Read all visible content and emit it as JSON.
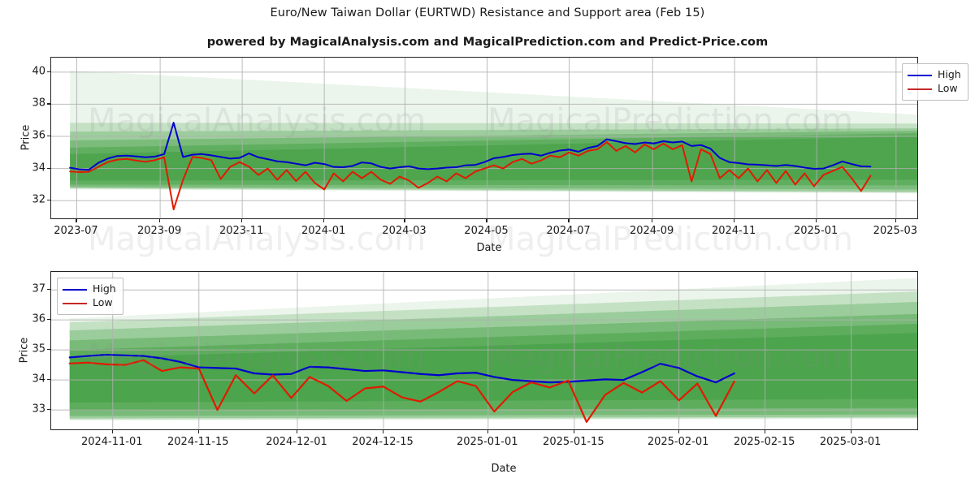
{
  "title": "Euro/New Taiwan Dollar (EURTWD) Resistance and Support area (Feb 15)",
  "subtitle": "powered by MagicalAnalysis.com and MagicalPrediction.com and Predict-Price.com",
  "watermarks": {
    "left": "MagicalAnalysis.com",
    "right": "MagicalPrediction.com"
  },
  "colors": {
    "high": "#0000cd",
    "low": "#e01b00",
    "legend_high": "#0000cd",
    "legend_low": "#c62828",
    "band": "#3a9b3a",
    "grid": "#b0b0b0",
    "axis": "#222222",
    "text": "#1a1a1a"
  },
  "chart_data": [
    {
      "type": "line",
      "id": "overview",
      "title": "Euro/New Taiwan Dollar (EURTWD) Resistance and Support area (Feb 15)",
      "xlabel": "Date",
      "ylabel": "Price",
      "ylim": [
        30.8,
        40.9
      ],
      "yticks": [
        32,
        34,
        36,
        38,
        40
      ],
      "xlim": [
        "2023-06-12",
        "2025-03-18"
      ],
      "xticks": [
        "2023-07",
        "2023-09",
        "2023-11",
        "2024-01",
        "2024-03",
        "2024-05",
        "2024-07",
        "2024-09",
        "2024-11",
        "2025-01",
        "2025-03"
      ],
      "grid": true,
      "legend": {
        "position": "upper-right",
        "entries": [
          "High",
          "Low"
        ]
      },
      "series": [
        {
          "name": "High",
          "color": "#0000cd",
          "x": [
            "2023-06-26",
            "2023-07-03",
            "2023-07-10",
            "2023-07-17",
            "2023-07-24",
            "2023-07-31",
            "2023-08-07",
            "2023-08-14",
            "2023-08-21",
            "2023-08-28",
            "2023-09-04",
            "2023-09-11",
            "2023-09-18",
            "2023-09-25",
            "2023-10-02",
            "2023-10-09",
            "2023-10-16",
            "2023-10-23",
            "2023-10-30",
            "2023-11-06",
            "2023-11-13",
            "2023-11-20",
            "2023-11-27",
            "2023-12-04",
            "2023-12-11",
            "2023-12-18",
            "2023-12-25",
            "2024-01-01",
            "2024-01-08",
            "2024-01-15",
            "2024-01-22",
            "2024-01-29",
            "2024-02-05",
            "2024-02-12",
            "2024-02-19",
            "2024-02-26",
            "2024-03-04",
            "2024-03-11",
            "2024-03-18",
            "2024-03-25",
            "2024-04-01",
            "2024-04-08",
            "2024-04-15",
            "2024-04-22",
            "2024-04-29",
            "2024-05-06",
            "2024-05-13",
            "2024-05-20",
            "2024-05-27",
            "2024-06-03",
            "2024-06-10",
            "2024-06-17",
            "2024-06-24",
            "2024-07-01",
            "2024-07-08",
            "2024-07-15",
            "2024-07-22",
            "2024-07-29",
            "2024-08-05",
            "2024-08-12",
            "2024-08-19",
            "2024-08-26",
            "2024-09-02",
            "2024-09-09",
            "2024-09-16",
            "2024-09-23",
            "2024-09-30",
            "2024-10-07",
            "2024-10-14",
            "2024-10-21",
            "2024-10-28",
            "2024-11-04",
            "2024-11-11",
            "2024-11-18",
            "2024-11-25",
            "2024-12-02",
            "2024-12-09",
            "2024-12-16",
            "2024-12-23",
            "2024-12-30",
            "2025-01-06",
            "2025-01-13",
            "2025-01-20",
            "2025-01-27",
            "2025-02-03",
            "2025-02-10"
          ],
          "values": [
            34.05,
            33.95,
            33.92,
            34.35,
            34.62,
            34.78,
            34.8,
            34.76,
            34.7,
            34.74,
            34.9,
            36.85,
            34.72,
            34.86,
            34.9,
            34.82,
            34.72,
            34.62,
            34.66,
            34.94,
            34.7,
            34.58,
            34.45,
            34.4,
            34.3,
            34.2,
            34.36,
            34.28,
            34.1,
            34.08,
            34.16,
            34.38,
            34.32,
            34.1,
            34.0,
            34.08,
            34.14,
            34.0,
            33.96,
            34.0,
            34.06,
            34.08,
            34.2,
            34.22,
            34.4,
            34.64,
            34.72,
            34.84,
            34.9,
            34.92,
            34.8,
            34.98,
            35.12,
            35.18,
            35.05,
            35.28,
            35.4,
            35.82,
            35.7,
            35.58,
            35.52,
            35.62,
            35.56,
            35.7,
            35.62,
            35.68,
            35.4,
            35.46,
            35.24,
            34.66,
            34.4,
            34.34,
            34.26,
            34.24,
            34.2,
            34.16,
            34.22,
            34.16,
            34.06,
            33.98,
            34.0,
            34.2,
            34.44,
            34.28,
            34.14,
            34.12
          ]
        },
        {
          "name": "Low",
          "color": "#e01b00",
          "x": [
            "2023-06-26",
            "2023-07-03",
            "2023-07-10",
            "2023-07-17",
            "2023-07-24",
            "2023-07-31",
            "2023-08-07",
            "2023-08-14",
            "2023-08-21",
            "2023-08-28",
            "2023-09-04",
            "2023-09-11",
            "2023-09-18",
            "2023-09-25",
            "2023-10-02",
            "2023-10-09",
            "2023-10-16",
            "2023-10-23",
            "2023-10-30",
            "2023-11-06",
            "2023-11-13",
            "2023-11-20",
            "2023-11-27",
            "2023-12-04",
            "2023-12-11",
            "2023-12-18",
            "2023-12-25",
            "2024-01-01",
            "2024-01-08",
            "2024-01-15",
            "2024-01-22",
            "2024-01-29",
            "2024-02-05",
            "2024-02-12",
            "2024-02-19",
            "2024-02-26",
            "2024-03-04",
            "2024-03-11",
            "2024-03-18",
            "2024-03-25",
            "2024-04-01",
            "2024-04-08",
            "2024-04-15",
            "2024-04-22",
            "2024-04-29",
            "2024-05-06",
            "2024-05-13",
            "2024-05-20",
            "2024-05-27",
            "2024-06-03",
            "2024-06-10",
            "2024-06-17",
            "2024-06-24",
            "2024-07-01",
            "2024-07-08",
            "2024-07-15",
            "2024-07-22",
            "2024-07-29",
            "2024-08-05",
            "2024-08-12",
            "2024-08-19",
            "2024-08-26",
            "2024-09-02",
            "2024-09-09",
            "2024-09-16",
            "2024-09-23",
            "2024-09-30",
            "2024-10-07",
            "2024-10-14",
            "2024-10-21",
            "2024-10-28",
            "2024-11-04",
            "2024-11-11",
            "2024-11-18",
            "2024-11-25",
            "2024-12-02",
            "2024-12-09",
            "2024-12-16",
            "2024-12-23",
            "2024-12-30",
            "2025-01-06",
            "2025-01-13",
            "2025-01-20",
            "2025-01-27",
            "2025-02-03",
            "2025-02-10"
          ],
          "values": [
            33.82,
            33.78,
            33.8,
            34.1,
            34.4,
            34.55,
            34.6,
            34.5,
            34.42,
            34.52,
            34.7,
            31.45,
            33.3,
            34.72,
            34.66,
            34.52,
            33.35,
            34.1,
            34.4,
            34.12,
            33.6,
            34.0,
            33.3,
            33.9,
            33.22,
            33.8,
            33.1,
            32.7,
            33.7,
            33.2,
            33.8,
            33.4,
            33.8,
            33.3,
            33.05,
            33.5,
            33.25,
            32.8,
            33.1,
            33.5,
            33.2,
            33.7,
            33.4,
            33.8,
            34.0,
            34.2,
            34.0,
            34.4,
            34.6,
            34.3,
            34.5,
            34.8,
            34.7,
            35.0,
            34.8,
            35.1,
            35.2,
            35.65,
            35.1,
            35.4,
            35.0,
            35.5,
            35.2,
            35.55,
            35.2,
            35.45,
            33.2,
            35.2,
            34.9,
            33.4,
            33.9,
            33.4,
            34.0,
            33.2,
            33.9,
            33.1,
            33.85,
            33.0,
            33.7,
            32.9,
            33.6,
            33.85,
            34.1,
            33.4,
            32.6,
            33.55
          ]
        }
      ],
      "bands": {
        "description": "Layered green resistance/support bands widening from center, narrowing toward right edge",
        "start": "2023-06-26",
        "end": "2025-03-18"
      }
    },
    {
      "type": "line",
      "id": "zoom",
      "xlabel": "Date",
      "ylabel": "Price",
      "ylim": [
        32.3,
        37.6
      ],
      "yticks": [
        33,
        34,
        35,
        36,
        37
      ],
      "xlim": [
        "2024-10-22",
        "2025-03-12"
      ],
      "xticks": [
        "2024-11-01",
        "2024-11-15",
        "2024-12-01",
        "2024-12-15",
        "2025-01-01",
        "2025-01-15",
        "2025-02-01",
        "2025-02-15",
        "2025-03-01"
      ],
      "grid": true,
      "legend": {
        "position": "upper-left",
        "entries": [
          "High",
          "Low"
        ]
      },
      "series": [
        {
          "name": "High",
          "color": "#0000cd",
          "x": [
            "2024-10-25",
            "2024-10-28",
            "2024-10-31",
            "2024-11-03",
            "2024-11-06",
            "2024-11-09",
            "2024-11-12",
            "2024-11-15",
            "2024-11-18",
            "2024-11-21",
            "2024-11-24",
            "2024-11-27",
            "2024-11-30",
            "2024-12-03",
            "2024-12-06",
            "2024-12-09",
            "2024-12-12",
            "2024-12-15",
            "2024-12-18",
            "2024-12-21",
            "2024-12-24",
            "2024-12-27",
            "2024-12-30",
            "2025-01-02",
            "2025-01-05",
            "2025-01-08",
            "2025-01-11",
            "2025-01-14",
            "2025-01-17",
            "2025-01-20",
            "2025-01-23",
            "2025-01-26",
            "2025-01-29",
            "2025-02-01",
            "2025-02-04",
            "2025-02-07",
            "2025-02-10"
          ],
          "values": [
            34.75,
            34.8,
            34.84,
            34.82,
            34.8,
            34.72,
            34.6,
            34.42,
            34.4,
            34.38,
            34.22,
            34.18,
            34.2,
            34.44,
            34.42,
            34.36,
            34.3,
            34.32,
            34.26,
            34.2,
            34.16,
            34.22,
            34.24,
            34.1,
            34.0,
            33.96,
            33.92,
            33.94,
            33.98,
            34.02,
            34.0,
            34.26,
            34.54,
            34.4,
            34.12,
            33.92,
            34.22
          ]
        },
        {
          "name": "Low",
          "color": "#e01b00",
          "x": [
            "2024-10-25",
            "2024-10-28",
            "2024-10-31",
            "2024-11-03",
            "2024-11-06",
            "2024-11-09",
            "2024-11-12",
            "2024-11-15",
            "2024-11-18",
            "2024-11-21",
            "2024-11-24",
            "2024-11-27",
            "2024-11-30",
            "2024-12-03",
            "2024-12-06",
            "2024-12-09",
            "2024-12-12",
            "2024-12-15",
            "2024-12-18",
            "2024-12-21",
            "2024-12-24",
            "2024-12-27",
            "2024-12-30",
            "2025-01-02",
            "2025-01-05",
            "2025-01-08",
            "2025-01-11",
            "2025-01-14",
            "2025-01-17",
            "2025-01-20",
            "2025-01-23",
            "2025-01-26",
            "2025-01-29",
            "2025-02-01",
            "2025-02-04",
            "2025-02-07",
            "2025-02-10"
          ],
          "values": [
            34.55,
            34.58,
            34.52,
            34.5,
            34.66,
            34.3,
            34.42,
            34.38,
            33.0,
            34.16,
            33.55,
            34.15,
            33.4,
            34.1,
            33.8,
            33.3,
            33.72,
            33.78,
            33.42,
            33.28,
            33.6,
            33.96,
            33.8,
            32.95,
            33.6,
            33.92,
            33.75,
            33.98,
            32.6,
            33.5,
            33.9,
            33.58,
            33.96,
            33.32,
            33.88,
            32.8,
            33.95
          ]
        }
      ],
      "bands": {
        "description": "Layered green resistance/support bands, widening slightly toward right edge",
        "start": "2024-10-25",
        "end": "2025-03-12"
      }
    }
  ]
}
